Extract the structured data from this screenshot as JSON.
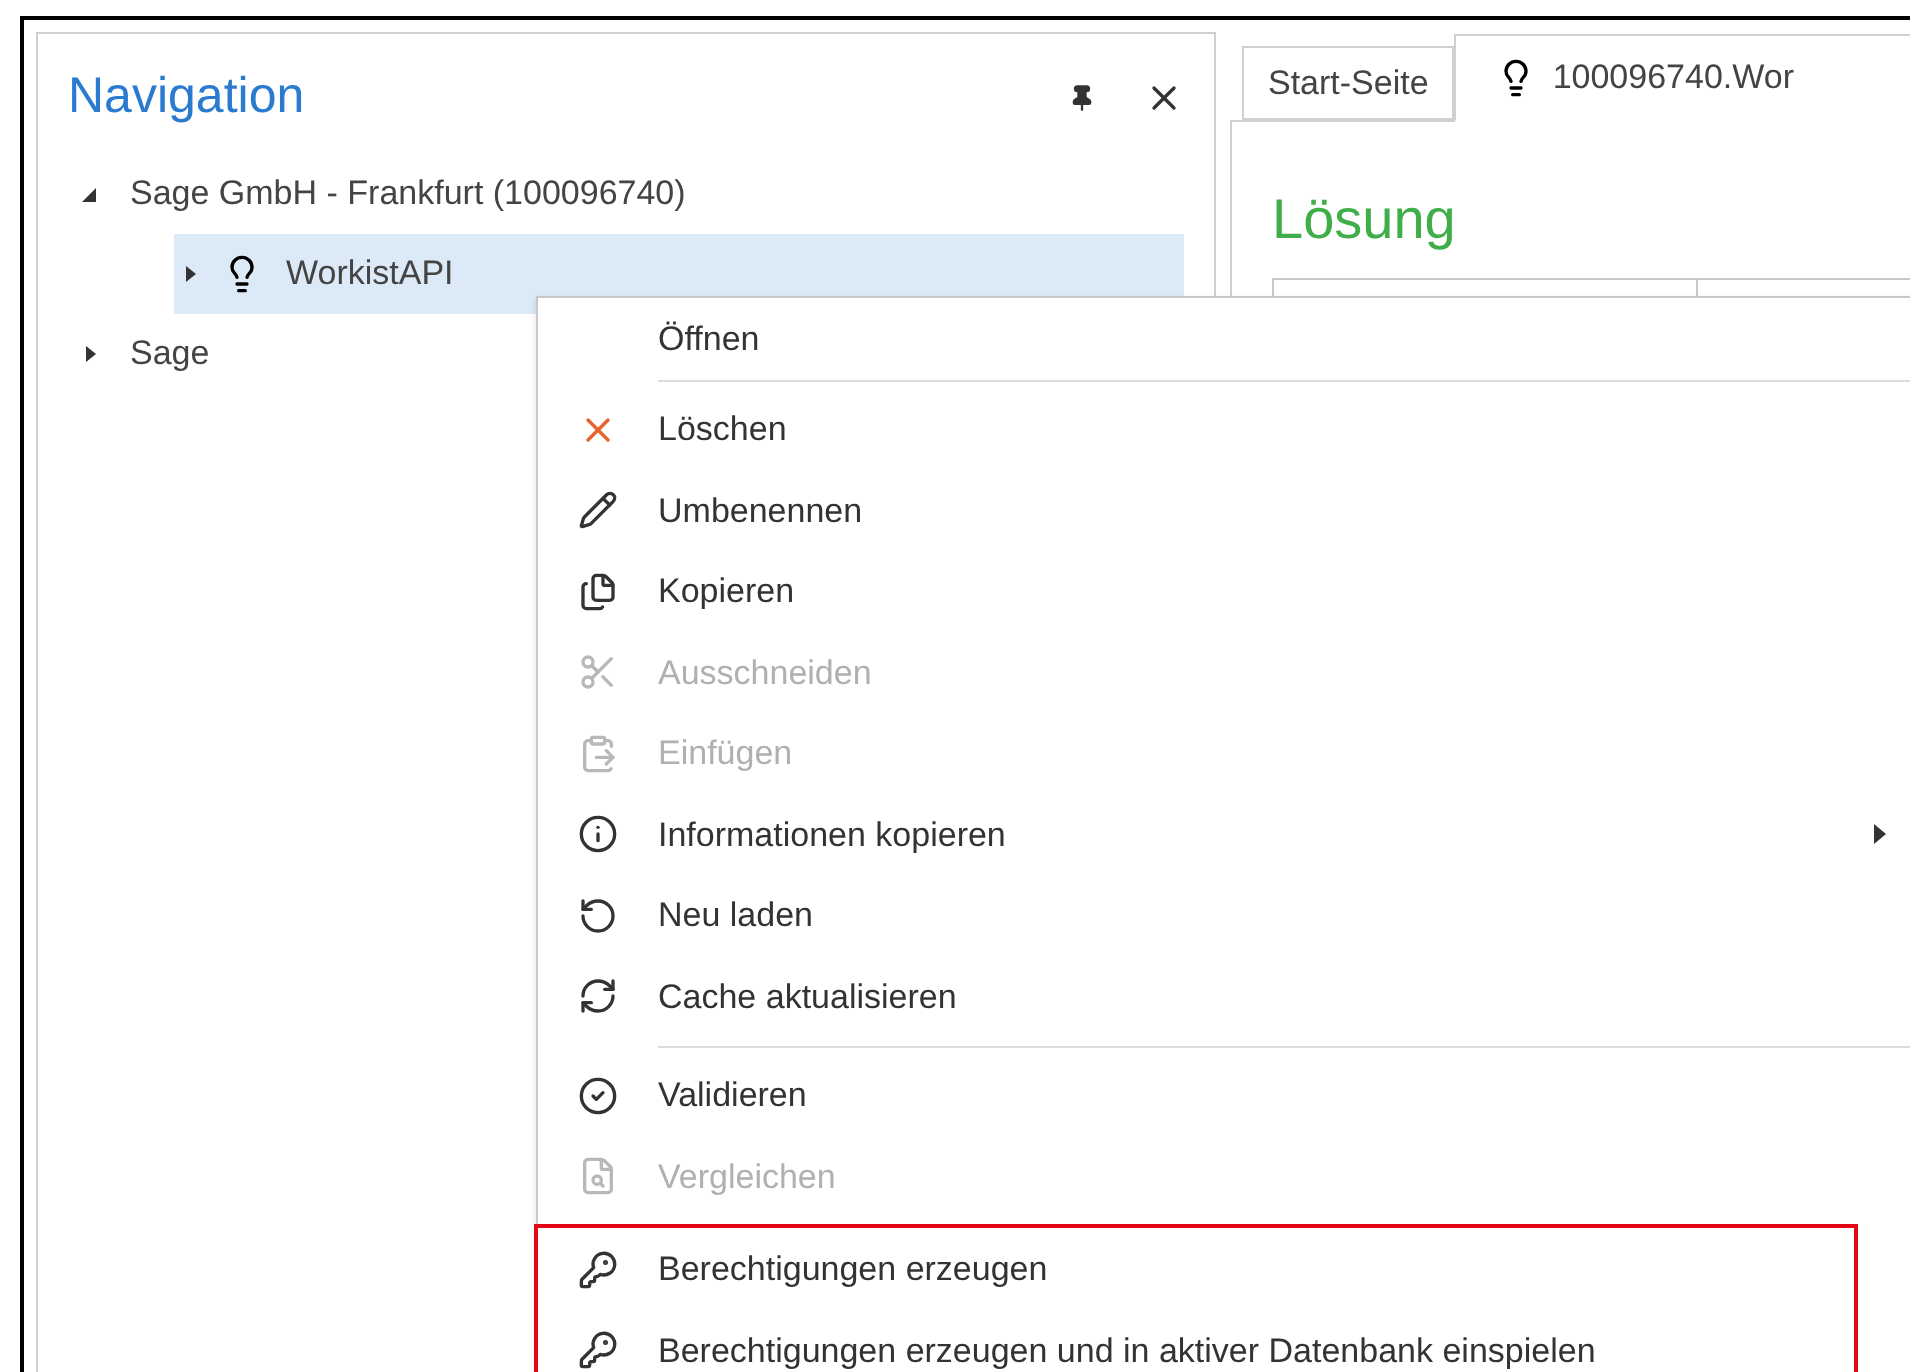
{
  "navigation": {
    "title": "Navigation",
    "tree": [
      {
        "label": "Sage GmbH - Frankfurt (100096740)",
        "expanded": true,
        "selected": false,
        "children": [
          {
            "label": "WorkistAPI",
            "expanded": false,
            "selected": true
          }
        ]
      },
      {
        "label": "Sage",
        "expanded": false,
        "selected": false
      }
    ]
  },
  "tabs": [
    {
      "label": "Start-Seite",
      "selected": false
    },
    {
      "label": "100096740.Wor",
      "selected": true
    }
  ],
  "content": {
    "title": "Lösung"
  },
  "context_menu": {
    "groups": [
      {
        "highlighted": false,
        "items": [
          {
            "label": "Öffnen",
            "disabled": false,
            "submenu": false
          }
        ]
      },
      {
        "highlighted": false,
        "items": [
          {
            "label": "Löschen",
            "disabled": false,
            "submenu": false
          },
          {
            "label": "Umbenennen",
            "disabled": false,
            "submenu": false
          },
          {
            "label": "Kopieren",
            "disabled": false,
            "submenu": false
          },
          {
            "label": "Ausschneiden",
            "disabled": true,
            "submenu": false
          },
          {
            "label": "Einfügen",
            "disabled": true,
            "submenu": false
          },
          {
            "label": "Informationen kopieren",
            "disabled": false,
            "submenu": true
          },
          {
            "label": "Neu laden",
            "disabled": false,
            "submenu": false
          },
          {
            "label": "Cache aktualisieren",
            "disabled": false,
            "submenu": false
          }
        ]
      },
      {
        "highlighted": false,
        "items": [
          {
            "label": "Validieren",
            "disabled": false,
            "submenu": false
          },
          {
            "label": "Vergleichen",
            "disabled": true,
            "submenu": false
          }
        ]
      },
      {
        "highlighted": true,
        "items": [
          {
            "label": "Berechtigungen erzeugen",
            "disabled": false,
            "submenu": false
          },
          {
            "label": "Berechtigungen erzeugen und in aktiver Datenbank einspielen",
            "disabled": false,
            "submenu": false
          }
        ]
      }
    ]
  }
}
